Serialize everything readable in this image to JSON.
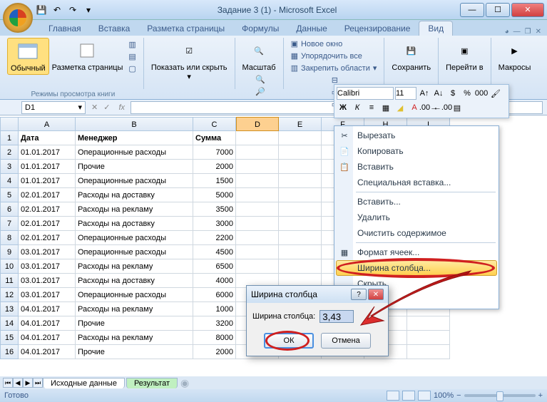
{
  "window": {
    "title": "Задание 3 (1) - Microsoft Excel"
  },
  "tabs": {
    "home": "Главная",
    "insert": "Вставка",
    "pagelayout": "Разметка страницы",
    "formulas": "Формулы",
    "data": "Данные",
    "review": "Рецензирование",
    "view": "Вид"
  },
  "ribbon": {
    "group_views": "Режимы просмотра книги",
    "normal": "Обычный",
    "pagelayout_btn": "Разметка страницы",
    "showhide": "Показать или скрыть",
    "zoom": "Масштаб",
    "newwindow": "Новое окно",
    "arrange": "Упорядочить все",
    "freeze": "Закрепить области",
    "save_workspace": "Сохранить",
    "switch_windows": "Перейти в",
    "macros": "Макросы"
  },
  "namebox": "D1",
  "columns": [
    "A",
    "B",
    "C",
    "D",
    "E",
    "F",
    "H",
    "I"
  ],
  "headers": {
    "A": "Дата",
    "B": "Менеджер",
    "C": "Сумма"
  },
  "rows": [
    {
      "n": 1
    },
    {
      "n": 2,
      "A": "01.01.2017",
      "B": "Операционные расходы",
      "C": "7000"
    },
    {
      "n": 3,
      "A": "01.01.2017",
      "B": "Прочие",
      "C": "2000"
    },
    {
      "n": 4,
      "A": "01.01.2017",
      "B": "Операционные расходы",
      "C": "1500"
    },
    {
      "n": 5,
      "A": "02.01.2017",
      "B": "Расходы на доставку",
      "C": "5000"
    },
    {
      "n": 6,
      "A": "02.01.2017",
      "B": "Расходы на рекламу",
      "C": "3500"
    },
    {
      "n": 7,
      "A": "02.01.2017",
      "B": "Расходы на доставку",
      "C": "3000"
    },
    {
      "n": 8,
      "A": "02.01.2017",
      "B": "Операционные расходы",
      "C": "2200"
    },
    {
      "n": 9,
      "A": "03.01.2017",
      "B": "Операционные расходы",
      "C": "4500"
    },
    {
      "n": 10,
      "A": "03.01.2017",
      "B": "Расходы на рекламу",
      "C": "6500"
    },
    {
      "n": 11,
      "A": "03.01.2017",
      "B": "Расходы на доставку",
      "C": "4000"
    },
    {
      "n": 12,
      "A": "03.01.2017",
      "B": "Операционные расходы",
      "C": "6000"
    },
    {
      "n": 13,
      "A": "04.01.2017",
      "B": "Расходы на рекламу",
      "C": "1000"
    },
    {
      "n": 14,
      "A": "04.01.2017",
      "B": "Прочие",
      "C": "3200"
    },
    {
      "n": 15,
      "A": "04.01.2017",
      "B": "Расходы на рекламу",
      "C": "8000"
    },
    {
      "n": 16,
      "A": "04.01.2017",
      "B": "Прочие",
      "C": "2000"
    }
  ],
  "sheets": {
    "tab1": "Исходные данные",
    "tab2": "Результат"
  },
  "status": {
    "ready": "Готово",
    "zoom": "100%"
  },
  "minibar": {
    "font": "Calibri",
    "size": "11"
  },
  "context": {
    "cut": "Вырезать",
    "copy": "Копировать",
    "paste": "Вставить",
    "pastespecial": "Специальная вставка...",
    "insert": "Вставить...",
    "delete": "Удалить",
    "clear": "Очистить содержимое",
    "format": "Формат ячеек...",
    "colwidth": "Ширина столбца...",
    "hide": "Скрыть",
    "unhide": "зить"
  },
  "dialog": {
    "title": "Ширина столбца",
    "label": "Ширина столбца:",
    "value": "3,43",
    "ok": "ОК",
    "cancel": "Отмена"
  }
}
